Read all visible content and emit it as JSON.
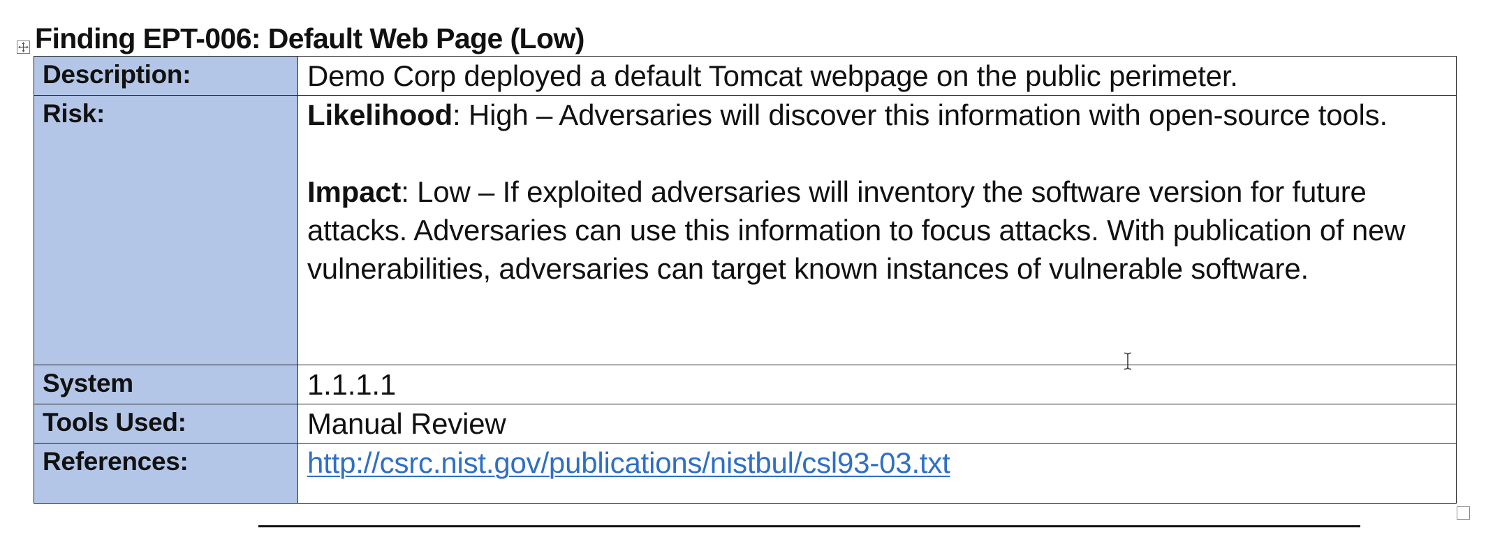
{
  "document": {
    "title": "Finding EPT-006: Default Web Page (Low)",
    "rows": {
      "description": {
        "label": "Description:",
        "value": "Demo Corp deployed a default Tomcat webpage on the public perimeter."
      },
      "risk": {
        "label": "Risk:",
        "likelihood_label": "Likelihood",
        "likelihood_text": ": High – Adversaries will discover this information with open-source tools.",
        "impact_label": "Impact",
        "impact_text": ": Low – If exploited adversaries will inventory the software version for future attacks. Adversaries can use this information to focus attacks. With publication of new vulnerabilities, adversaries can target known instances of vulnerable software."
      },
      "system": {
        "label": "System",
        "value": "1.1.1.1"
      },
      "tools": {
        "label": "Tools Used:",
        "value": "Manual Review"
      },
      "references": {
        "label": "References:",
        "link": "http://csrc.nist.gov/publications/nistbul/csl93-03.txt"
      }
    }
  },
  "icons": {
    "table_handle": "table-move-handle-icon",
    "cursor": "text-cursor-icon",
    "resize": "table-resize-handle-icon"
  },
  "colors": {
    "label_background": "#b4c6e7",
    "link": "#2e6fc7",
    "border": "#222222"
  }
}
